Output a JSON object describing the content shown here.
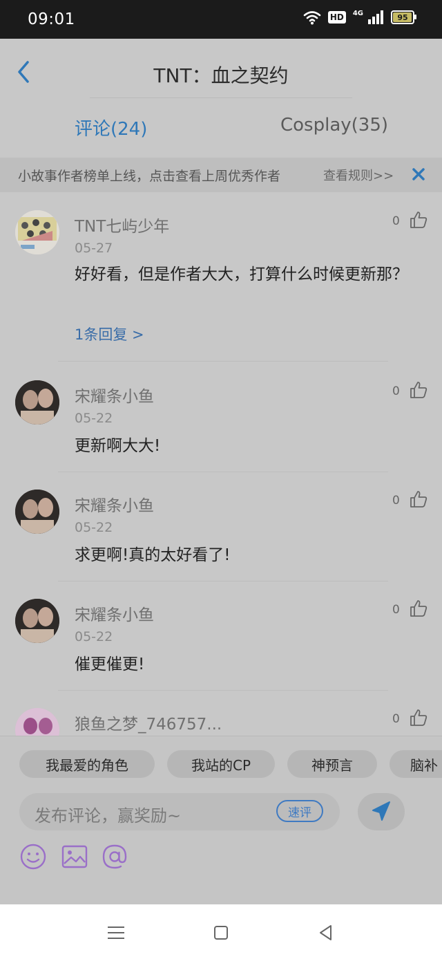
{
  "status_bar": {
    "time": "09:01",
    "hd": "HD",
    "network": "4G",
    "battery": "95",
    "battery_level": 0.95
  },
  "header": {
    "title": "TNT：血之契约",
    "back_icon": "chevron-left-icon"
  },
  "tabs": [
    {
      "label": "评论(24)",
      "active": true
    },
    {
      "label": "Cosplay(35)",
      "active": false
    }
  ],
  "notice": {
    "text": "小故事作者榜单上线，点击查看上周优秀作者",
    "link": "查看规则>>",
    "close_icon": "close-icon"
  },
  "comments": [
    {
      "username": "TNT七屿少年",
      "date": "05-27",
      "content": "好好看，但是作者大大，打算什么时候更新那？",
      "reply": "1条回复 >",
      "likes": "0"
    },
    {
      "username": "宋耀条小鱼",
      "date": "05-22",
      "content": "更新啊大大!",
      "likes": "0"
    },
    {
      "username": "宋耀条小鱼",
      "date": "05-22",
      "content": "求更啊!真的太好看了!",
      "likes": "0"
    },
    {
      "username": "宋耀条小鱼",
      "date": "05-22",
      "content": "催更催更!",
      "likes": "0"
    },
    {
      "username": "狼鱼之梦_746757...",
      "likes": "0"
    }
  ],
  "quick_tags": [
    "我最爱的角色",
    "我站的CP",
    "神预言",
    "脑补"
  ],
  "composer": {
    "placeholder": "发布评论，赢奖励~",
    "quick_review": "速评",
    "send_icon": "send-icon",
    "tools": [
      "emoji-icon",
      "image-icon",
      "mention-icon"
    ]
  },
  "nav_bar": [
    "menu-icon",
    "home-icon",
    "back-icon"
  ],
  "colors": {
    "accent": "#2f78b8",
    "overlay_bg": "#c8c8c8",
    "status_bar": "#1b1b1b"
  }
}
